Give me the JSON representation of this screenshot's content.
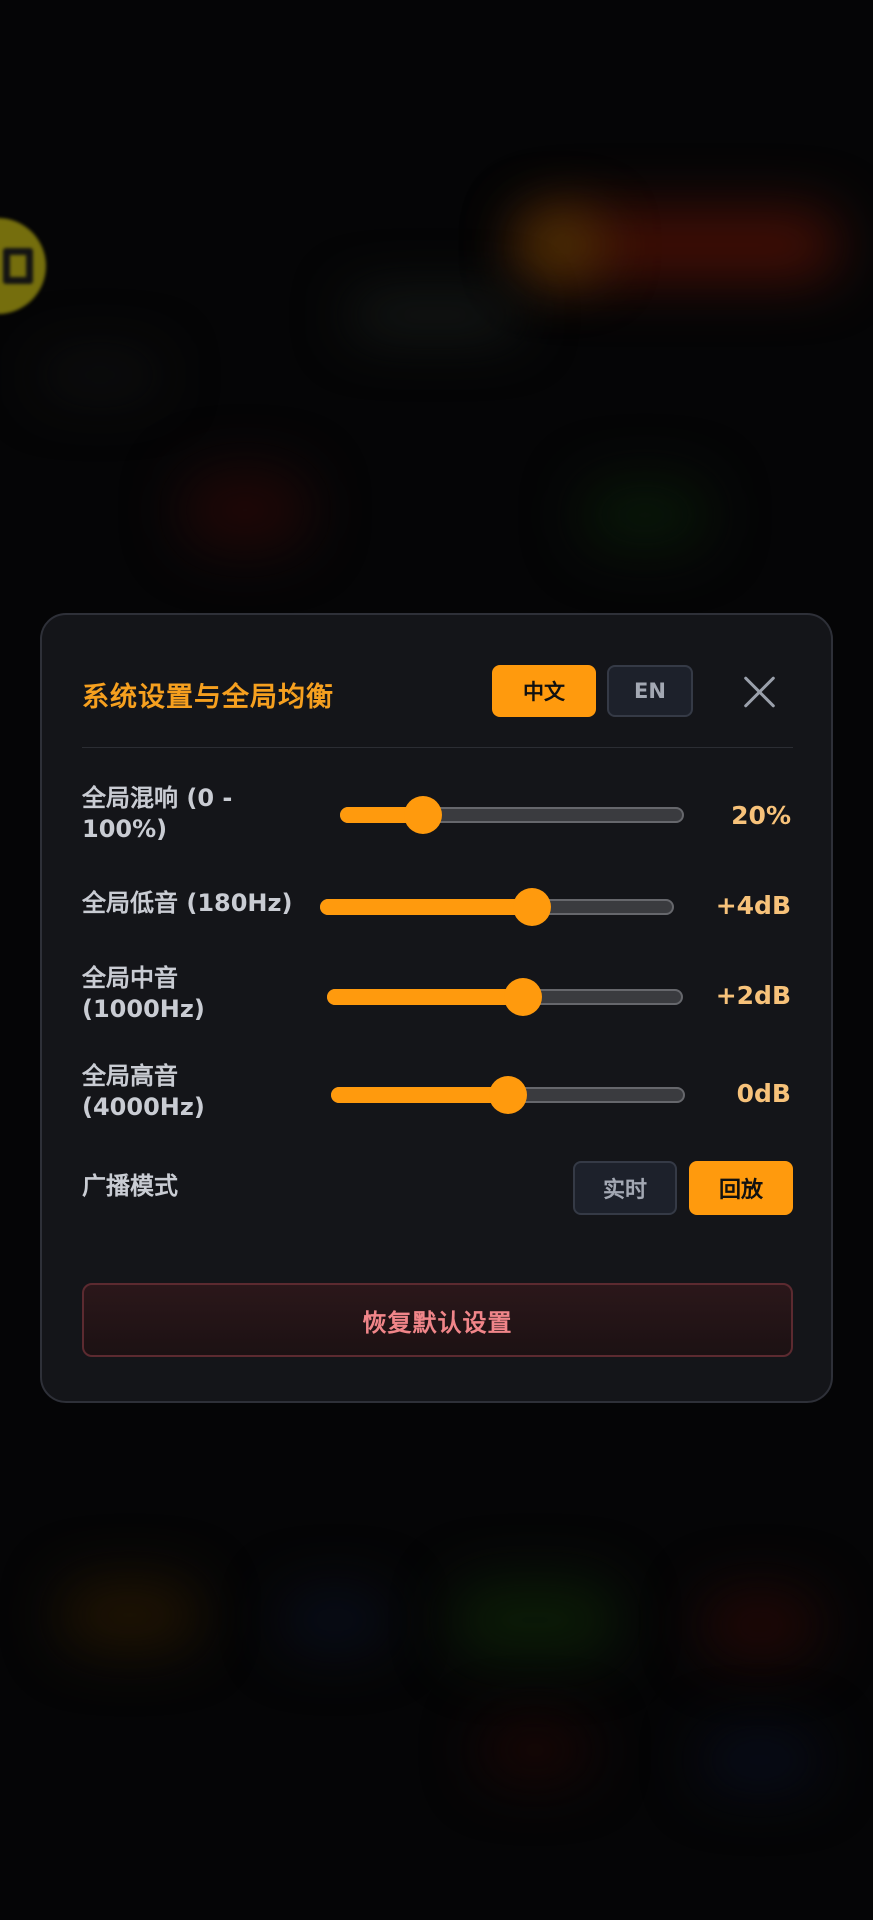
{
  "modal": {
    "title": "系统设置与全局均衡",
    "lang_zh": "中文",
    "lang_en": "EN",
    "active_language": "zh",
    "accent_color": "#ff9a0d"
  },
  "settings": {
    "reverb": {
      "label": "全局混响 (0 - 100%)",
      "value_text": "20%",
      "level": 0.24
    },
    "bass": {
      "label": "全局低音 (180Hz)",
      "value_text": "+4dB",
      "level": 0.6
    },
    "mid": {
      "label": "全局中音 (1000Hz)",
      "value_text": "+2dB",
      "level": 0.55
    },
    "treble": {
      "label": "全局高音 (4000Hz)",
      "value_text": "0dB",
      "level": 0.5
    }
  },
  "broadcast": {
    "label": "广播模式",
    "live_label": "实时",
    "replay_label": "回放",
    "selected": "replay"
  },
  "reset_label": "恢复默认设置"
}
